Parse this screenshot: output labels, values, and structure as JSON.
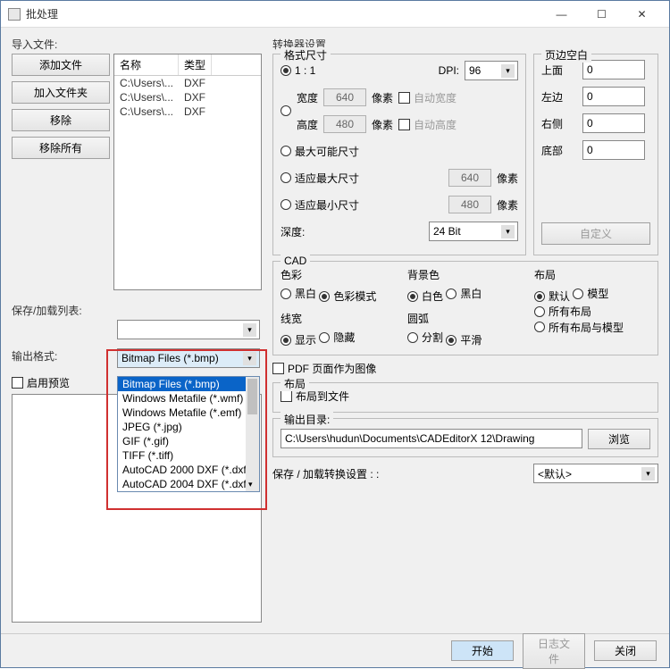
{
  "window": {
    "title": "批处理"
  },
  "left": {
    "import_label": "导入文件:",
    "buttons": {
      "add_file": "添加文件",
      "add_folder": "加入文件夹",
      "remove": "移除",
      "remove_all": "移除所有"
    },
    "table": {
      "headers": {
        "name": "名称",
        "type": "类型"
      },
      "rows": [
        {
          "name": "C:\\Users\\...",
          "type": "DXF"
        },
        {
          "name": "C:\\Users\\...",
          "type": "DXF"
        },
        {
          "name": "C:\\Users\\...",
          "type": "DXF"
        }
      ]
    },
    "save_list_label": "保存/加载列表:",
    "output_format_label": "输出格式:",
    "output_format_value": "Bitmap Files (*.bmp)",
    "dropdown_items": [
      "Bitmap Files (*.bmp)",
      "Windows Metafile (*.wmf)",
      "Windows Metafile (*.emf)",
      "JPEG (*.jpg)",
      "GIF (*.gif)",
      "TIFF (*.tiff)",
      "AutoCAD 2000 DXF (*.dxf)",
      "AutoCAD 2004 DXF (*.dxf)"
    ],
    "enable_preview": "启用预览"
  },
  "conv": {
    "title": "转换器设置",
    "format_size": {
      "title": "格式尺寸",
      "ratio_11": "1 : 1",
      "dpi_label": "DPI:",
      "dpi_value": "96",
      "width_label": "宽度",
      "width_value": "640",
      "px": "像素",
      "auto_width": "自动宽度",
      "height_label": "高度",
      "height_value": "480",
      "auto_height": "自动高度",
      "max_possible": "最大可能尺寸",
      "fit_max": "适应最大尺寸",
      "fit_max_val": "640",
      "fit_min": "适应最小尺寸",
      "fit_min_val": "480",
      "depth_label": "深度:",
      "depth_value": "24 Bit"
    },
    "margins": {
      "title": "页边空白",
      "top": "上面",
      "left": "左边",
      "right": "右侧",
      "bottom": "底部",
      "top_v": "0",
      "left_v": "0",
      "right_v": "0",
      "bottom_v": "0",
      "custom": "自定义"
    },
    "cad": {
      "title": "CAD",
      "color": {
        "title": "色彩",
        "bw": "黑白",
        "color": "色彩模式"
      },
      "bg": {
        "title": "背景色",
        "white": "白色",
        "black": "黑白"
      },
      "layout": {
        "title": "布局",
        "default": "默认",
        "model": "模型",
        "all": "所有布局",
        "all_model": "所有布局与模型"
      },
      "linew": {
        "title": "线宽",
        "show": "显示",
        "hide": "隐藏"
      },
      "arc": {
        "title": "圆弧",
        "split": "分割",
        "smooth": "平滑"
      }
    },
    "pdf_as_image": "PDF 页面作为图像",
    "layout_section": {
      "title": "布局",
      "to_file": "布局到文件"
    },
    "outdir_label": "输出目录:",
    "outdir_value": "C:\\Users\\hudun\\Documents\\CADEditorX 12\\Drawing",
    "browse": "浏览",
    "save_conv_label": "保存 / 加载转换设置 : :",
    "save_conv_value": "<默认>"
  },
  "footer": {
    "start": "开始",
    "log": "日志文件",
    "close": "关闭"
  }
}
